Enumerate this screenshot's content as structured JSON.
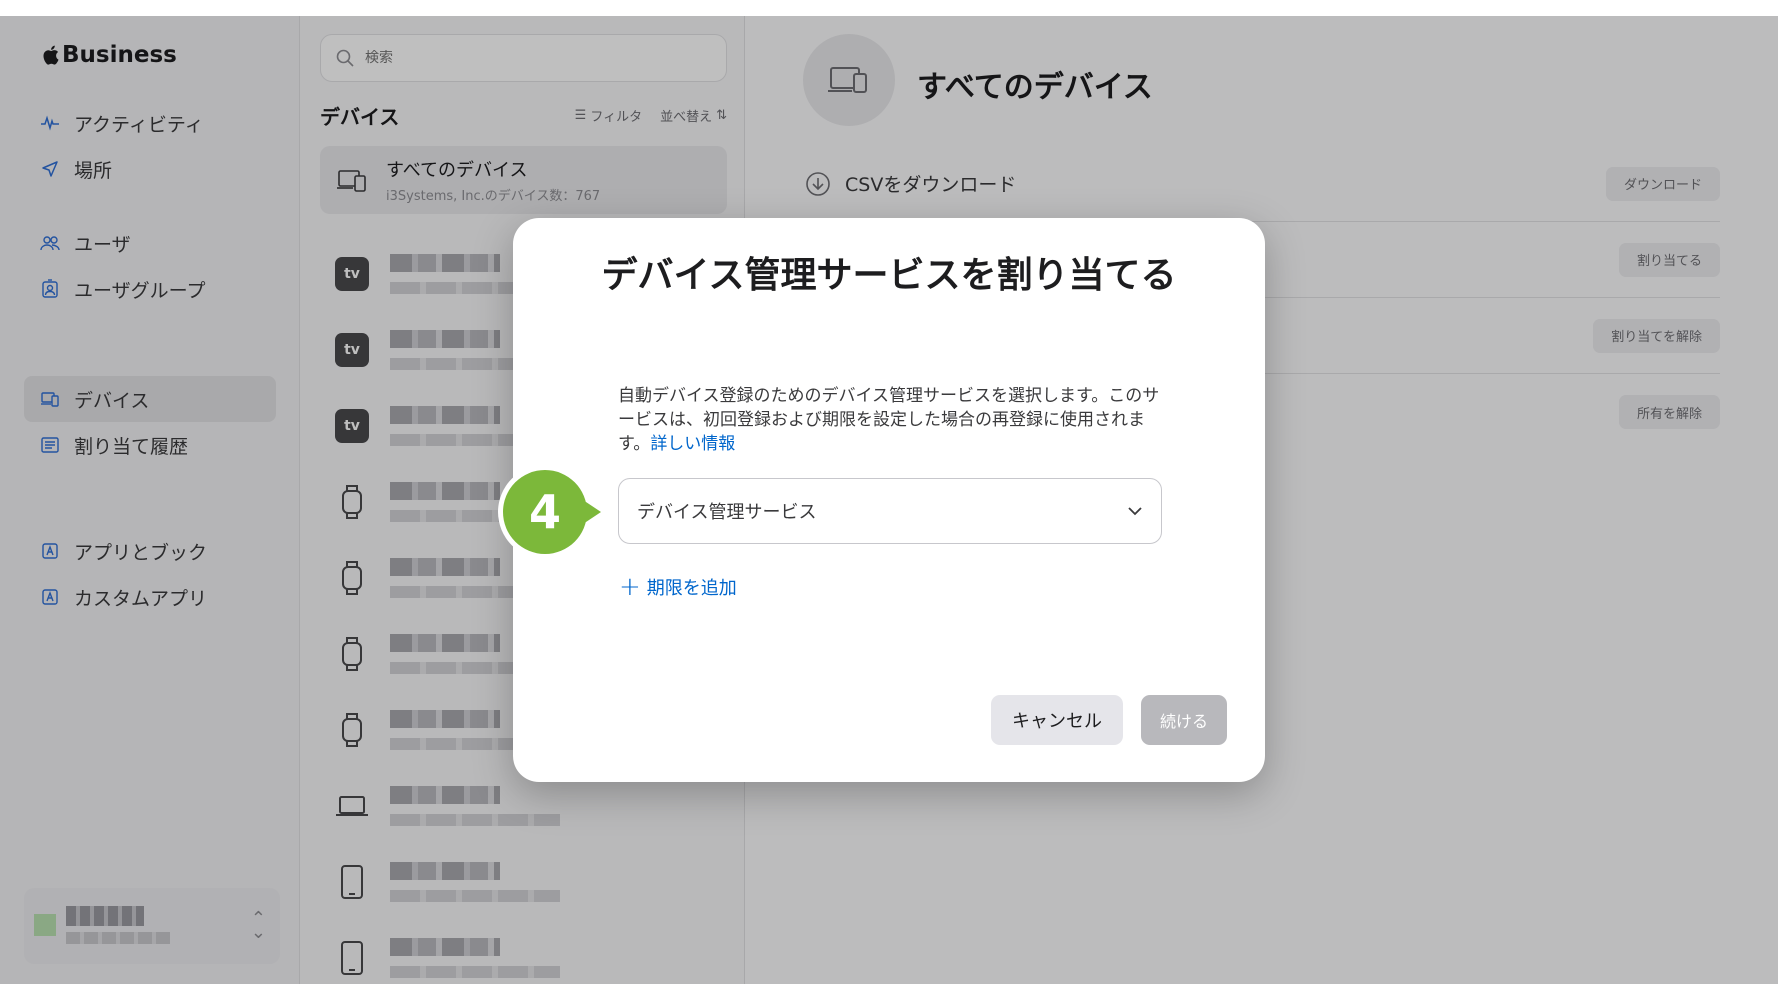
{
  "sidebar": {
    "brand": "Business",
    "items": [
      {
        "label": "アクティビティ",
        "icon": "activity-icon"
      },
      {
        "label": "場所",
        "icon": "location-arrow-icon"
      },
      {
        "label": "ユーザ",
        "icon": "users-icon"
      },
      {
        "label": "ユーザグループ",
        "icon": "user-group-icon"
      },
      {
        "label": "デバイス",
        "icon": "devices-icon",
        "active": true
      },
      {
        "label": "割り当て履歴",
        "icon": "assignment-history-icon"
      },
      {
        "label": "アプリとブック",
        "icon": "apps-books-icon"
      },
      {
        "label": "カスタムアプリ",
        "icon": "custom-apps-icon"
      }
    ]
  },
  "list": {
    "search_placeholder": "検索",
    "title": "デバイス",
    "filter_label": "フィルタ",
    "sort_label": "並べ替え",
    "all_devices": {
      "title": "すべてのデバイス",
      "subtitle": "i3Systems, Inc.のデバイス数：767"
    },
    "rows": [
      {
        "type": "tv"
      },
      {
        "type": "tv"
      },
      {
        "type": "tv"
      },
      {
        "type": "watch"
      },
      {
        "type": "watch"
      },
      {
        "type": "watch"
      },
      {
        "type": "watch"
      },
      {
        "type": "laptop"
      },
      {
        "type": "tablet"
      },
      {
        "type": "tablet"
      }
    ],
    "tv_badge": "tv"
  },
  "detail": {
    "title": "すべてのデバイス",
    "actions": [
      {
        "label": "CSVをダウンロード",
        "button": "ダウンロード"
      },
      {
        "label": "",
        "button": "割り当てる"
      },
      {
        "label": "",
        "button": "割り当てを解除"
      },
      {
        "label": "",
        "button": "所有を解除"
      }
    ]
  },
  "modal": {
    "title": "デバイス管理サービスを割り当てる",
    "description": "自動デバイス登録のためのデバイス管理サービスを選択します。このサービスは、初回登録および期限を設定した場合の再登録に使用されます。",
    "learn_more": "詳しい情報",
    "select_value": "デバイス管理サービス",
    "add_limit": "期限を追加",
    "cancel": "キャンセル",
    "continue": "続ける"
  },
  "callout": {
    "step": "4",
    "color": "#7cb83a"
  },
  "colors": {
    "accent": "#0066cc",
    "sidebar_icon": "#2f6fd6"
  }
}
